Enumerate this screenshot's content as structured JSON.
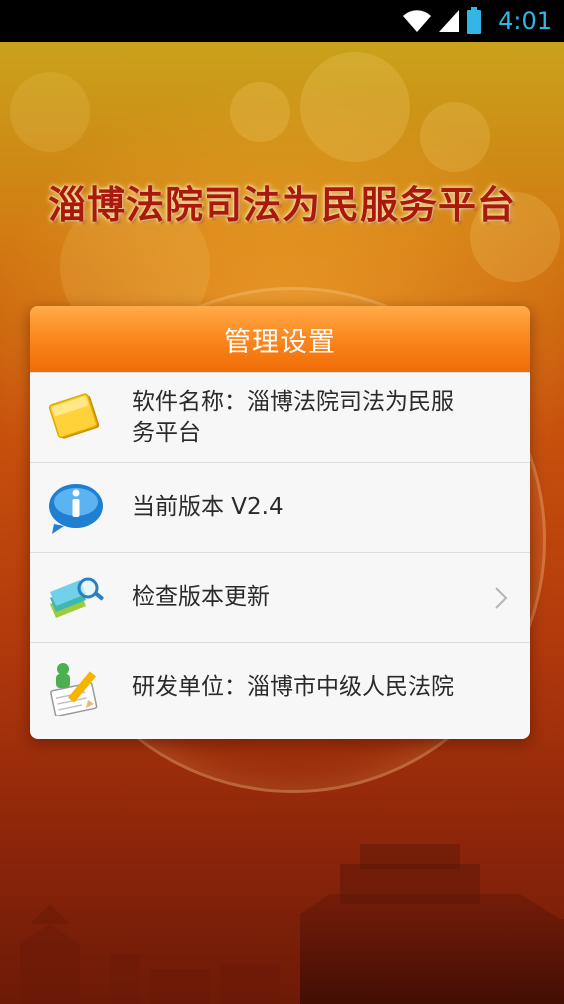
{
  "status_bar": {
    "time": "4:01",
    "icons": [
      "wifi-icon",
      "signal-icon",
      "battery-icon"
    ],
    "time_color": "#33b5e5"
  },
  "app": {
    "title": "淄博法院司法为民服务平台"
  },
  "dialog": {
    "title": "管理设置",
    "header_color": "#f7780f",
    "items": [
      {
        "icon": "document-icon",
        "label": "软件名称：淄博法院司法为民服务平台"
      },
      {
        "icon": "info-icon",
        "label": "当前版本 V2.4"
      },
      {
        "icon": "search-books-icon",
        "label": "检查版本更新",
        "has_chevron": true
      },
      {
        "icon": "edit-user-icon",
        "label": "研发单位：淄博市中级人民法院"
      }
    ]
  }
}
